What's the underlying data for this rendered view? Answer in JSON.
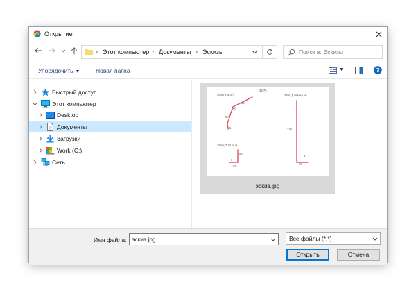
{
  "window": {
    "title": "Открытие",
    "app_icon": "chrome-icon",
    "close_icon": "close-icon"
  },
  "nav": {
    "back_icon": "arrow-left-icon",
    "forward_icon": "arrow-right-icon",
    "recent_icon": "chevron-down-icon",
    "up_icon": "arrow-up-icon",
    "breadcrumbs": [
      "Этот компьютер",
      "Документы",
      "Эскизы"
    ],
    "refresh_icon": "refresh-icon",
    "search_placeholder": "Поиск в: Эскизы",
    "search_icon": "search-icon"
  },
  "toolbar": {
    "organize_label": "Упорядочить",
    "new_folder_label": "Новая папка",
    "view_icon": "view-options-icon",
    "preview_icon": "preview-pane-icon",
    "help_icon": "help-icon"
  },
  "tree": [
    {
      "label": "Быстрый доступ",
      "icon": "star-icon"
    },
    {
      "label": "Этот компьютер",
      "icon": "computer-icon"
    },
    {
      "label": "Desktop",
      "icon": "desktop-folder-icon"
    },
    {
      "label": "Документы",
      "icon": "documents-icon"
    },
    {
      "label": "Загрузки",
      "icon": "downloads-icon"
    },
    {
      "label": "Work (C:)",
      "icon": "drive-icon"
    },
    {
      "label": "Сеть",
      "icon": "network-icon"
    }
  ],
  "file": {
    "name": "эскиз.jpg",
    "sketch": {
      "top_label": "34,75",
      "drawing_1_title": "36m (6 кв.м)",
      "drawing_1_dims": [
        "90",
        "90",
        "90",
        "5"
      ],
      "drawing_2_title": "36m (5,94м кв.м)",
      "drawing_2_dims": [
        "120",
        "5",
        "33"
      ],
      "drawing_3_title": "36m ( 2,34 кв.м )",
      "drawing_3_dims": [
        "5",
        "90",
        "30"
      ]
    }
  },
  "footer": {
    "filename_label": "Имя файла:",
    "filename_value": "эскиз.jpg",
    "filter_value": "Все файлы (*.*)",
    "open_label": "Открыть",
    "cancel_label": "Отмена"
  }
}
